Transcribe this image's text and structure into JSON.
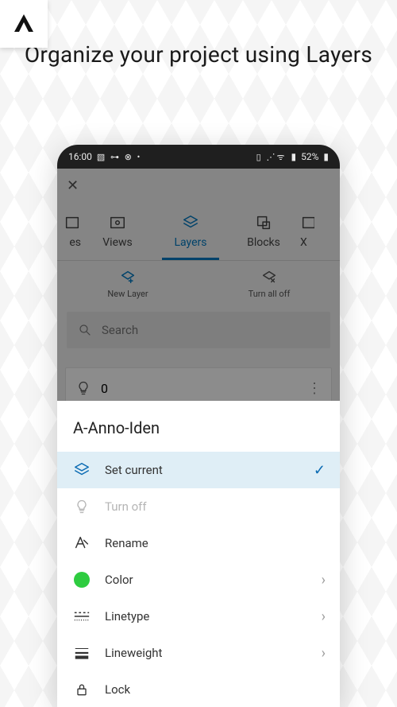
{
  "headline": "Organize your project using Layers",
  "status": {
    "time": "16:00",
    "left_icons": "▧ ⊶ ⊗ •",
    "right_icons": "▯ ⋰ᯤ",
    "battery_text": "52%"
  },
  "tabs": {
    "left_partial": "es",
    "items": [
      {
        "label": "Views"
      },
      {
        "label": "Layers",
        "active": true
      },
      {
        "label": "Blocks"
      }
    ],
    "right_partial": "X"
  },
  "actions": {
    "new_layer": "New Layer",
    "turn_all_off": "Turn all off"
  },
  "search": {
    "placeholder": "Search"
  },
  "layer_preview": {
    "name": "0"
  },
  "sheet": {
    "title": "A-Anno-Iden",
    "items": {
      "set_current": "Set current",
      "turn_off": "Turn off",
      "rename": "Rename",
      "color": "Color",
      "linetype": "Linetype",
      "lineweight": "Lineweight",
      "lock": "Lock"
    },
    "color_hex": "#2ecc40"
  }
}
